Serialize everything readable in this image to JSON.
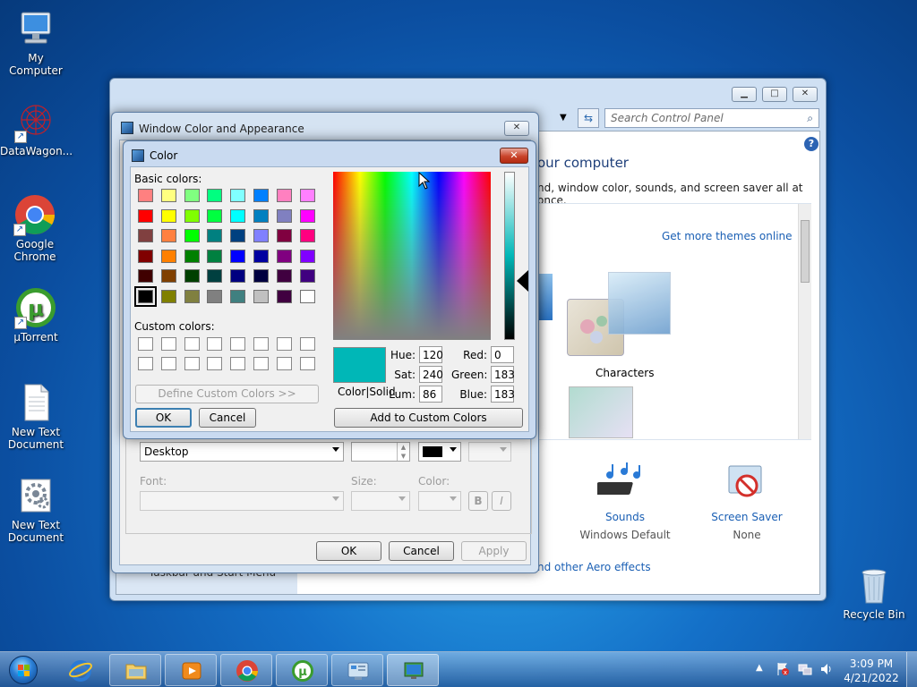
{
  "desktop": {
    "icons": [
      {
        "label": "My Computer"
      },
      {
        "label": "DataWagon..."
      },
      {
        "label": "Google Chrome"
      },
      {
        "label": "µTorrent"
      },
      {
        "label": "New Text Document"
      },
      {
        "label": "New Text Document"
      },
      {
        "label": "Recycle Bin"
      }
    ]
  },
  "control_panel": {
    "search_placeholder": "Search Control Panel",
    "heading": "our computer",
    "subheading": "nd, window color, sounds, and screen saver all at once.",
    "get_more_themes": "Get more themes online",
    "theme_characters": "Characters",
    "sounds_label": "Sounds",
    "sounds_value": "Windows Default",
    "screensaver_label": "Screen Saver",
    "screensaver_value": "None",
    "aero_link": "nd other Aero effects",
    "sidebar_text": "Taskbar and Start Menu",
    "help_glyph": "?"
  },
  "wca_dialog": {
    "title": "Window Color and Appearance",
    "item_value": "Desktop",
    "font_label": "Font:",
    "size_label": "Size:",
    "color_label": "Color:",
    "bold_label": "B",
    "italic_label": "I",
    "ok": "OK",
    "cancel": "Cancel",
    "apply": "Apply"
  },
  "color_dialog": {
    "title": "Color",
    "close_glyph": "✕",
    "basic_colors_label": "Basic colors:",
    "custom_colors_label": "Custom colors:",
    "define_custom": "Define Custom Colors >>",
    "ok": "OK",
    "cancel": "Cancel",
    "add_custom": "Add to Custom Colors",
    "color_solid": "Color|Solid",
    "hue_label": "Hue:",
    "sat_label": "Sat:",
    "lum_label": "Lum:",
    "red_label": "Red:",
    "green_label": "Green:",
    "blue_label": "Blue:",
    "hue": "120",
    "sat": "240",
    "lum": "86",
    "red": "0",
    "green": "183",
    "blue": "183",
    "selected_color": "#00b7b7",
    "basic_colors": [
      "#ff8080",
      "#ffff80",
      "#80ff80",
      "#00ff80",
      "#80ffff",
      "#0080ff",
      "#ff80c0",
      "#ff80ff",
      "#ff0000",
      "#ffff00",
      "#80ff00",
      "#00ff40",
      "#00ffff",
      "#0080c0",
      "#8080c0",
      "#ff00ff",
      "#804040",
      "#ff8040",
      "#00ff00",
      "#008080",
      "#004080",
      "#8080ff",
      "#800040",
      "#ff0080",
      "#800000",
      "#ff8000",
      "#008000",
      "#008040",
      "#0000ff",
      "#0000a0",
      "#800080",
      "#8000ff",
      "#400000",
      "#804000",
      "#004000",
      "#004040",
      "#000080",
      "#000040",
      "#400040",
      "#400080",
      "#000000",
      "#808000",
      "#808040",
      "#808080",
      "#408080",
      "#c0c0c0",
      "#400040",
      "#ffffff"
    ]
  },
  "taskbar": {
    "time": "3:09 PM",
    "date": "4/21/2022"
  }
}
